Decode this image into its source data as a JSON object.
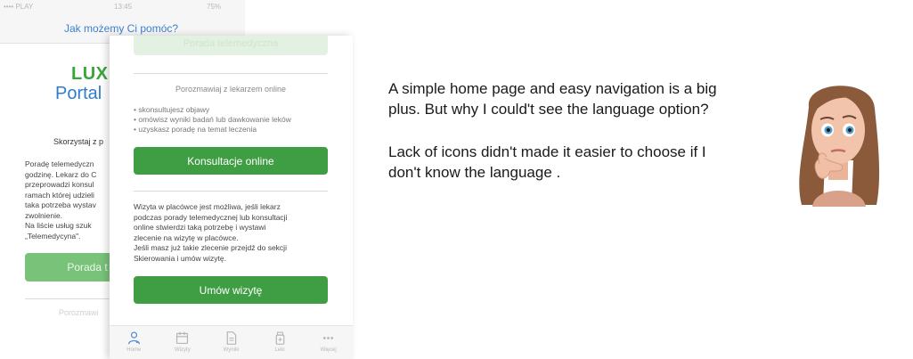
{
  "back_phone": {
    "status_carrier": "•••• PLAY",
    "status_time": "13:45",
    "status_battery": "75%",
    "nav_title": "Jak możemy Ci pomóc?",
    "logo_lux": "LUX",
    "logo_portal": "Portal",
    "skorzystaj": "Skorzystaj z p",
    "paragraph": "Poradę telemedyczn\ngodzinę. Lekarz do C\nprzeprowadzi konsul\nramach której udzieli\ntaka potrzeba wystav\nzwolnienie.\n Na liście usług szuk\n„Telemedycyna\".",
    "button_label": "Porada t",
    "bottom_text": "Porozmawi"
  },
  "front_phone": {
    "top_button_label": "Porada telemedyczna",
    "subtitle": "Porozmawiaj z lekarzem online",
    "bullets": [
      "• skonsultujesz objawy",
      "• omówisz wyniki badań lub dawkowanie leków",
      "• uzyskasz poradę na temat leczenia"
    ],
    "consult_button": "Konsultacje online",
    "wizyta_text": "Wizyta w placówce jest możliwa, jeśli lekarz\npodczas porady telemedycznej lub konsultacji\nonline stwierdzi taką potrzebę i wystawi\nzlecenie na wizytę w placówce.\nJeśli masz już takie zlecenie przejdź do sekcji\nSkierowania i umów wizytę.",
    "appointment_button": "Umów wizytę",
    "tabs": [
      {
        "label": "Home",
        "icon": "doctor-icon"
      },
      {
        "label": "Wizyty",
        "icon": "calendar-icon"
      },
      {
        "label": "Wyniki",
        "icon": "document-icon"
      },
      {
        "label": "Leki",
        "icon": "medicine-icon"
      },
      {
        "label": "Więcej",
        "icon": "more-icon"
      }
    ]
  },
  "commentary": {
    "paragraph_1": " A simple home page and easy navigation is a big\nplus. But why I could't see the language option?",
    "paragraph_2": "Lack of icons didn't made it easier to choose if I\ndon't know the language ."
  },
  "colors": {
    "brand_green": "#3f9e44",
    "logo_blue": "#2f7dc8",
    "nav_blue": "#3c7fd0"
  }
}
